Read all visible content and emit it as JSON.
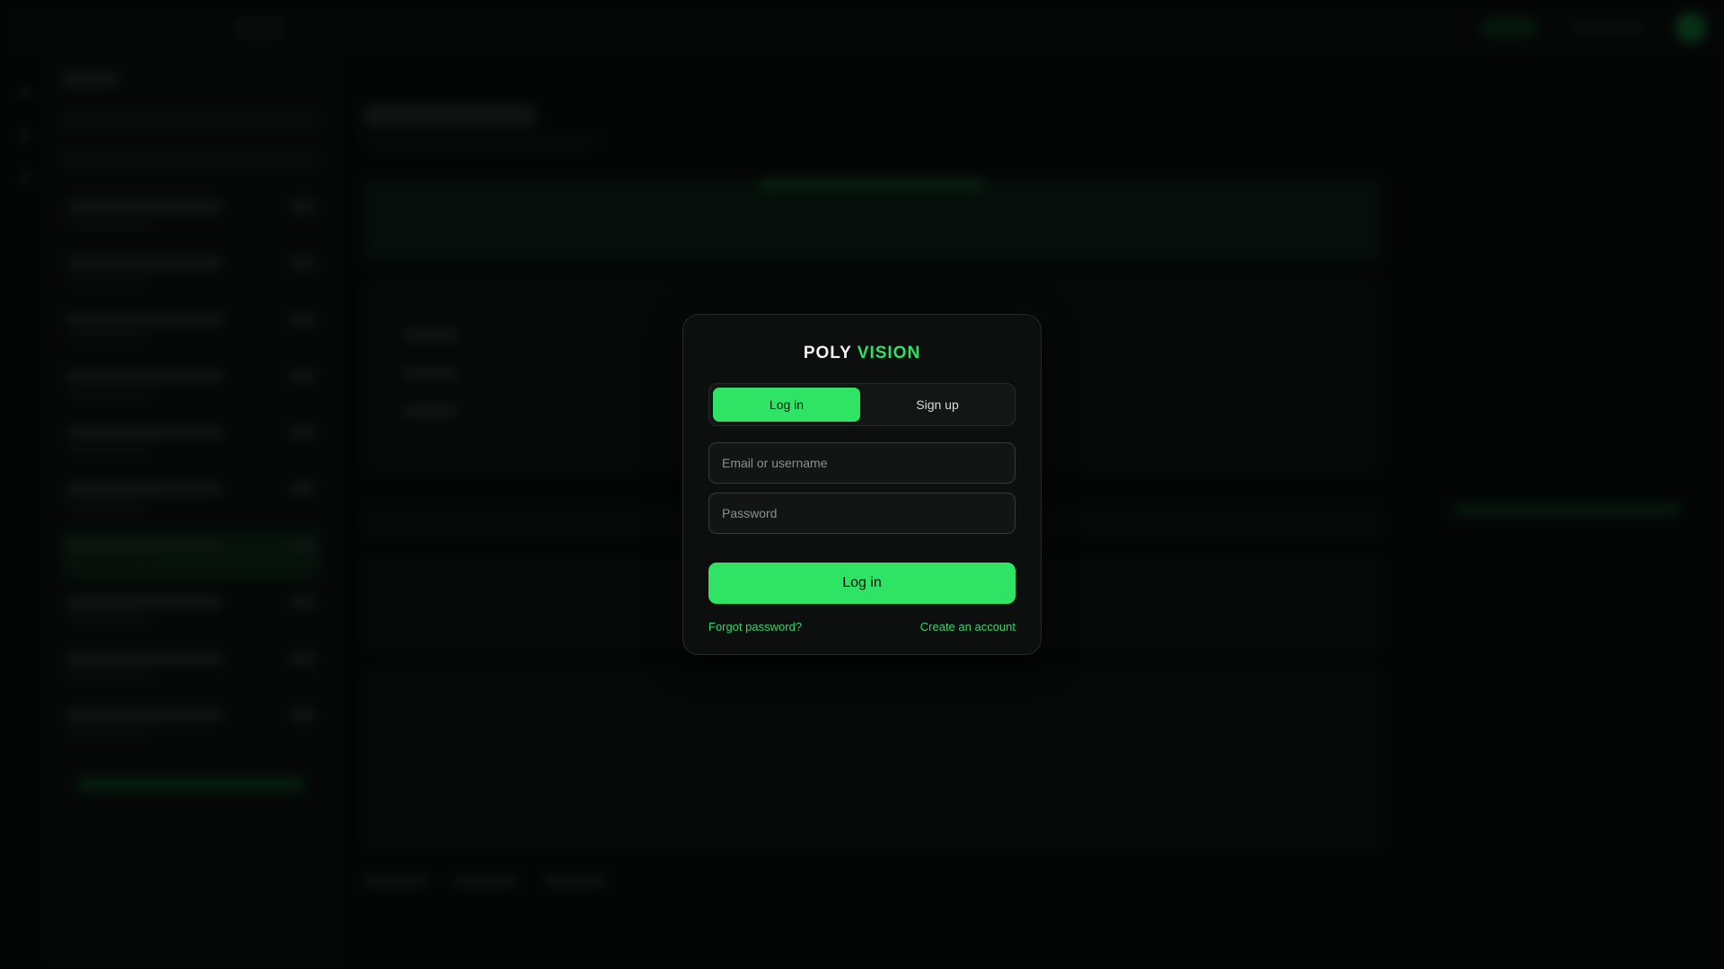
{
  "brand": {
    "part1": "POLY",
    "part2": "VISION"
  },
  "auth_tabs": {
    "login": "Log in",
    "signup": "Sign up",
    "active": "login"
  },
  "form": {
    "identifier_placeholder": "Email or username",
    "identifier_value": "",
    "password_placeholder": "Password",
    "password_value": "",
    "submit_label": "Log in"
  },
  "links": {
    "forgot": "Forgot password?",
    "create": "Create an account"
  },
  "colors": {
    "accent": "#2fe364",
    "brand_accent": "#2fe06a",
    "link": "#39d66c",
    "modal_bg": "#0c0f0e",
    "page_bg": "#060a09"
  }
}
